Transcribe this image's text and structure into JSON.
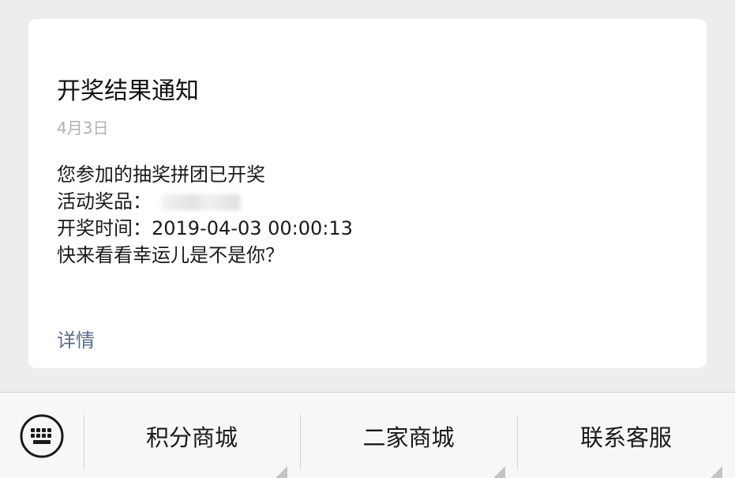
{
  "message_card": {
    "title": "开奖结果通知",
    "date": "4月3日",
    "body_lines": {
      "intro": "您参加的抽奖拼团已开奖",
      "prize_label": "活动奖品：",
      "draw_time_label": "开奖时间：",
      "draw_time_value": "2019-04-03 00:00:13",
      "closing": "快来看看幸运儿是不是你？"
    },
    "detail_link": "详情"
  },
  "menu_bar": {
    "keyboard_icon": "keyboard-icon",
    "items": [
      {
        "label": "积分商城"
      },
      {
        "label": "二家商城"
      },
      {
        "label": "联系客服"
      }
    ]
  },
  "colors": {
    "background": "#ededed",
    "card": "#ffffff",
    "link": "#576b95",
    "date_text": "#b2b2b2",
    "menu_bar": "#f7f7f7"
  }
}
